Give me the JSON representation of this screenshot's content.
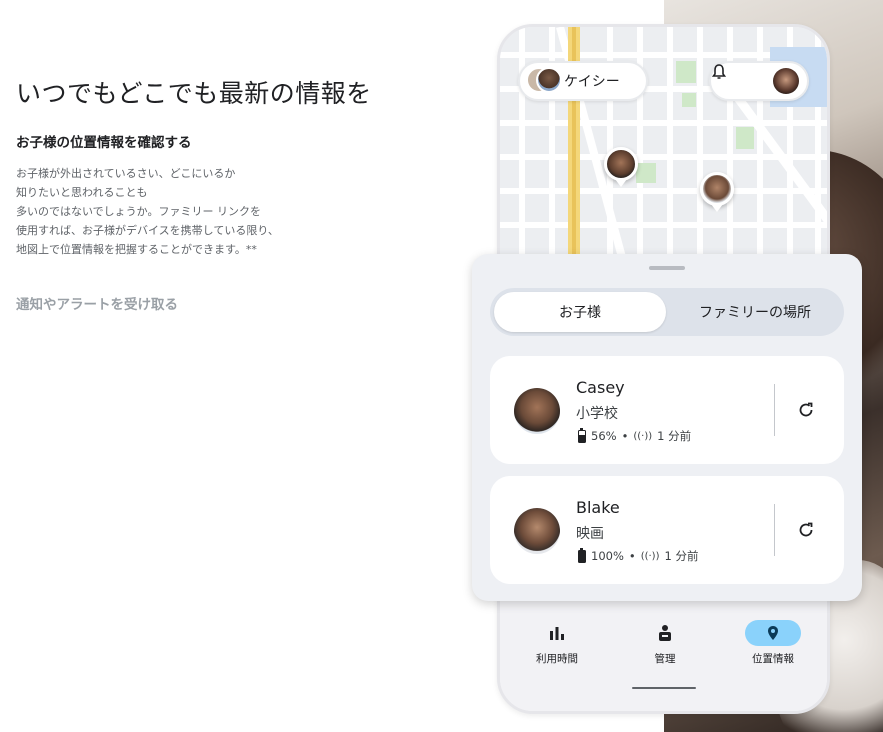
{
  "left": {
    "headline": "いつでもどこでも最新の情報を",
    "subhead": "お子様の位置情報を確認する",
    "body": [
      "お子様が外出されているさい、どこにいるか",
      "知りたいと思われることも",
      "多いのではないでしょうか。ファミリー リンクを",
      "使用すれば、お子様がデバイスを携帯している限り、",
      "地図上で位置情報を把握することができます。**"
    ],
    "alerts_link": "通知やアラートを受け取る"
  },
  "phone": {
    "account_pill": {
      "name": "ケイシー"
    },
    "icons": {
      "notifications": "bell-icon",
      "avatar": "user-avatar"
    },
    "sheet": {
      "tabs": [
        {
          "label": "お子様",
          "selected": true
        },
        {
          "label": "ファミリーの場所",
          "selected": false
        }
      ],
      "children": [
        {
          "name": "Casey",
          "place": "小学校",
          "battery_text": "56%",
          "battery_level": 0.56,
          "separator": "•",
          "updated": "1 分前"
        },
        {
          "name": "Blake",
          "place": "映画",
          "battery_text": "100%",
          "battery_level": 1.0,
          "separator": "•",
          "updated": "1 分前"
        }
      ]
    },
    "nav": [
      {
        "label": "利用時間",
        "icon": "bar-chart-icon",
        "glyph": "ılı",
        "active": false
      },
      {
        "label": "管理",
        "icon": "person-badge-icon",
        "glyph": "⍝",
        "active": false
      },
      {
        "label": "位置情報",
        "icon": "location-pin-icon",
        "glyph": "⬤",
        "active": true
      }
    ]
  },
  "colors": {
    "accent": "#8ad2fb",
    "map_major_road": "#f4d77a",
    "sheet_bg": "#eef0f4"
  }
}
